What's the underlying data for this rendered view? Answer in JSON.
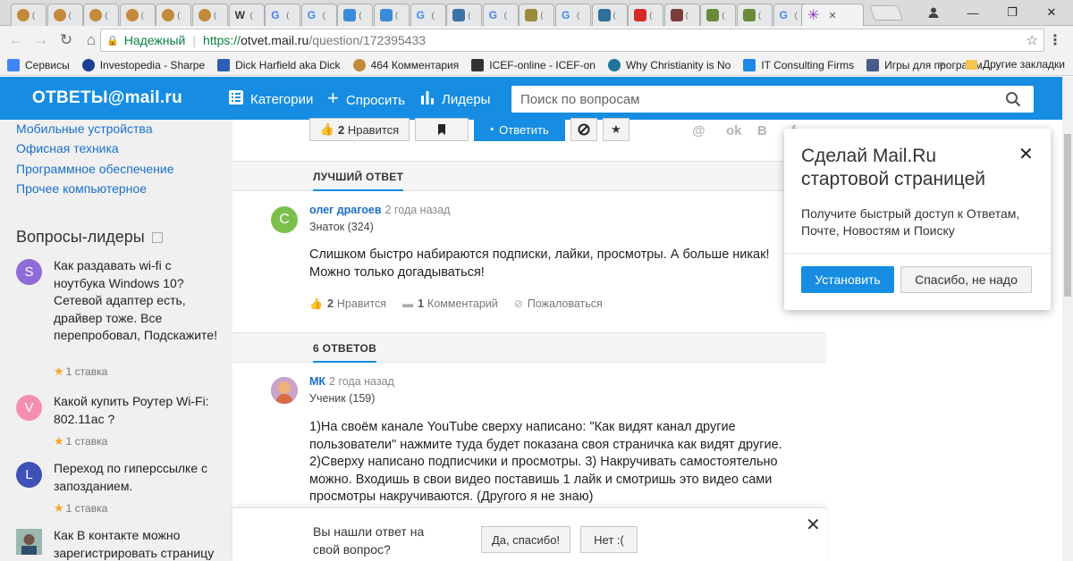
{
  "browser": {
    "tabs": [
      {
        "icon": "cookie-icon",
        "color": "#c28a3a"
      },
      {
        "icon": "cookie-icon",
        "color": "#c28a3a"
      },
      {
        "icon": "cookie-icon",
        "color": "#c28a3a"
      },
      {
        "icon": "cookie-icon",
        "color": "#c28a3a"
      },
      {
        "icon": "cookie-icon",
        "color": "#c28a3a"
      },
      {
        "icon": "cookie-icon",
        "color": "#c28a3a"
      },
      {
        "icon": "wikipedia-icon",
        "color": "#ffffff",
        "glyph": "W"
      },
      {
        "icon": "google-icon",
        "color": "#ffffff",
        "glyph": "G"
      },
      {
        "icon": "google-icon",
        "color": "#ffffff",
        "glyph": "G"
      },
      {
        "icon": "chart-icon",
        "color": "#3b8bd6"
      },
      {
        "icon": "chart-icon",
        "color": "#3b8bd6"
      },
      {
        "icon": "google-icon",
        "color": "#ffffff",
        "glyph": "G"
      },
      {
        "icon": "python-icon",
        "color": "#3b73a8"
      },
      {
        "icon": "google-icon",
        "color": "#ffffff",
        "glyph": "G"
      },
      {
        "icon": "image-icon",
        "color": "#9b8a3a"
      },
      {
        "icon": "google-icon",
        "color": "#ffffff",
        "glyph": "G"
      },
      {
        "icon": "site-icon",
        "color": "#2f6f9a"
      },
      {
        "icon": "youtube-icon",
        "color": "#d62a2a"
      },
      {
        "icon": "photo-icon",
        "color": "#7a3b3b"
      },
      {
        "icon": "emblem-icon",
        "color": "#6a8a3a"
      },
      {
        "icon": "emblem-icon",
        "color": "#6a8a3a"
      },
      {
        "icon": "google-icon",
        "color": "#ffffff",
        "glyph": "G"
      }
    ],
    "active_tab_icon": "asterisk-icon",
    "address": {
      "secure_label": "Надежный",
      "scheme": "https://",
      "host": "otvet.mail.ru",
      "path": "/question/172395433"
    },
    "bookmarks": [
      {
        "label": "Сервисы",
        "icon": "apps-icon",
        "color": "#4285f4"
      },
      {
        "label": "Investopedia - Sharpe",
        "icon": "investopedia-icon",
        "color": "#1c3f94"
      },
      {
        "label": "Dick Harfield aka Dick",
        "icon": "ae-icon",
        "color": "#2b5fb3"
      },
      {
        "label": "464 Комментария",
        "icon": "cookie-icon",
        "color": "#c28a3a"
      },
      {
        "label": "ICEF-online - ICEF-on",
        "icon": "icef-icon",
        "color": "#333333"
      },
      {
        "label": "Why Christianity is No",
        "icon": "wordpress-icon",
        "color": "#21759b"
      },
      {
        "label": "IT Consulting Firms",
        "icon": "it-icon",
        "color": "#1e88e5"
      },
      {
        "label": "Игры для программ",
        "icon": "monitor-icon",
        "color": "#4a5a8a"
      }
    ],
    "bookmarks_more": "»",
    "other_bookmarks": "Другие закладки"
  },
  "site": {
    "logo": "ОТВЕТЫ@mail.ru",
    "nav": {
      "categories": "Категории",
      "ask": "Спросить",
      "leaders": "Лидеры"
    },
    "search_placeholder": "Поиск по вопросам"
  },
  "sidebar": {
    "categories": [
      "Мобильные устройства",
      "Офисная техника",
      "Программное обеспечение",
      "Прочее компьютерное"
    ],
    "leaders_title": "Вопросы-лидеры",
    "leader_questions": [
      {
        "avatar_letter": "S",
        "avatar_color": "#8e6bd6",
        "text": "Как раздавать wi-fi с ноутбука Windows 10? Сетевой адаптер есть, драйвер тоже. Все перепробовал, Подскажите!",
        "stake": "1 ставка"
      },
      {
        "avatar_letter": "V",
        "avatar_color": "#f48fb1",
        "text": "Какой купить Роутер Wi-Fi: 802.11ac ?",
        "stake": "1 ставка"
      },
      {
        "avatar_letter": "L",
        "avatar_color": "#3f51b5",
        "text": "Переход по гиперссылке с запозданием.",
        "stake": "1 ставка"
      },
      {
        "avatar_letter": "",
        "avatar_color": "#6b8e8a",
        "text": "Как В контакте можно зарегистрировать страницу",
        "stake": ""
      }
    ]
  },
  "question_actions": {
    "like_count": "2",
    "like_label": "Нравится",
    "reply_label": "Ответить"
  },
  "best_answer": {
    "header": "ЛУЧШИЙ ОТВЕТ",
    "avatar_letter": "С",
    "avatar_color": "#7cc04b",
    "author": "олег драгоев",
    "time": "2 года назад",
    "rank": "Знаток (324)",
    "text": "Слишком быстро набираются подписки, лайки, просмотры. А больше никак! Можно только догадываться!",
    "likes": "2",
    "like_label": "Нравится",
    "comments": "1",
    "comment_label": "Комментарий",
    "report_label": "Пожаловаться"
  },
  "answers": {
    "header": "6 ОТВЕТОВ",
    "items": [
      {
        "author": "МК",
        "time": "2 года назад",
        "rank": "Ученик (159)",
        "avatar_color": "#d98a6a",
        "text": "1)На своём канале YouTube сверху написано: \"Как видят канал другие пользователи\" нажмите туда будет показана своя страничка как видят другие. 2)Сверху написано подписчики и просмотры. 3) Накручивать самостоятельно можно. Входишь в свои видео поставишь 1 лайк и смотришь это видео сами просмотры накручиваются. (Другого я не знаю)"
      }
    ]
  },
  "feedback": {
    "question": "Вы нашли ответ на свой вопрос?",
    "yes": "Да, спасибо!",
    "no": "Нет :("
  },
  "popup": {
    "title": "Сделай Mail.Ru стартовой страницей",
    "text": "Получите быстрый доступ к Ответам, Почте, Новостям и Поиску",
    "install": "Установить",
    "decline": "Спасибо, не надо"
  },
  "colors": {
    "brand_blue": "#168de2",
    "link_blue": "#1a6fc9",
    "secure_green": "#0b8043",
    "stake_star": "#f5a623"
  }
}
